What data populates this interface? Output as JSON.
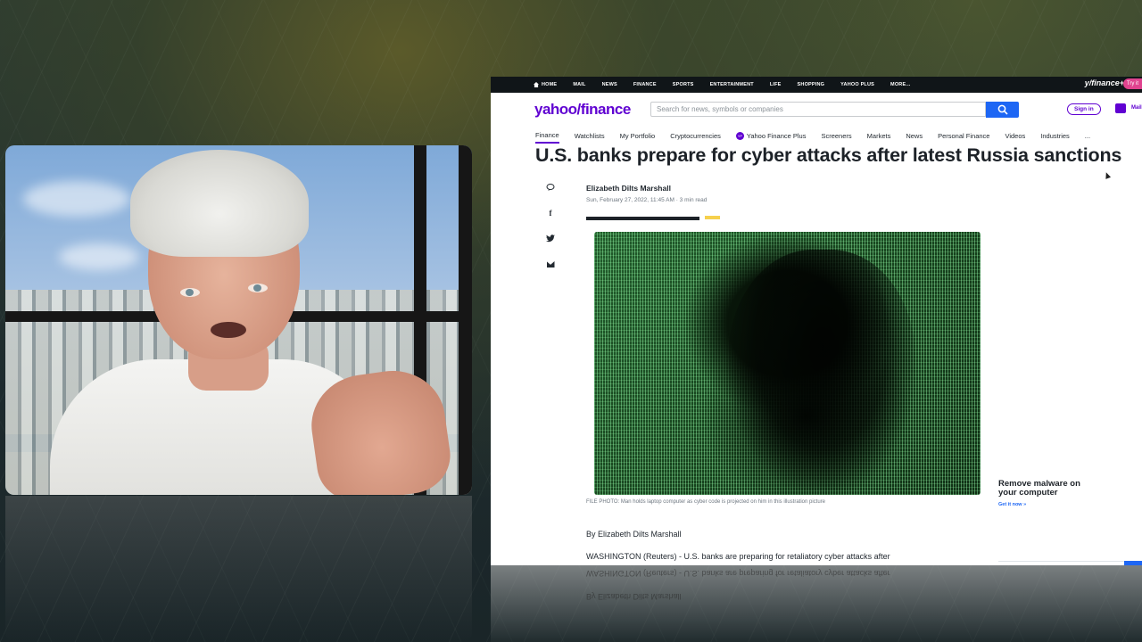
{
  "topnav": {
    "items": [
      "HOME",
      "MAIL",
      "NEWS",
      "FINANCE",
      "SPORTS",
      "ENTERTAINMENT",
      "LIFE",
      "SHOPPING",
      "YAHOO PLUS",
      "MORE..."
    ],
    "brand": "y/finance+",
    "try_label": "Try it"
  },
  "header": {
    "logo_text": "yahoo/finance",
    "search_placeholder": "Search for news, symbols or companies",
    "signin_label": "Sign in",
    "mail_label": "Mail"
  },
  "subnav": {
    "items": [
      "Finance",
      "Watchlists",
      "My Portfolio",
      "Cryptocurrencies",
      "Yahoo Finance Plus",
      "Screeners",
      "Markets",
      "News",
      "Personal Finance",
      "Videos",
      "Industries",
      "..."
    ],
    "active": "Finance"
  },
  "article": {
    "headline": "U.S. banks prepare for cyber attacks after latest Russia sanctions",
    "author": "Elizabeth Dilts Marshall",
    "date": "Sun, February 27, 2022, 11:45 AM",
    "read_time": "3 min read",
    "date_line": "Sun, February 27, 2022, 11:45 AM · 3 min read",
    "caption": "FILE PHOTO: Man holds laptop computer as cyber code is projected on him in this illustration picture",
    "byline": "By Elizabeth Dilts Marshall",
    "body_first_line": "WASHINGTON (Reuters) - U.S. banks are preparing for retaliatory cyber attacks after"
  },
  "ad": {
    "title": "Remove malware on your computer",
    "link": "Get it now »"
  },
  "colors": {
    "brand_purple": "#6001d2",
    "search_blue": "#1d66f4",
    "topnav_bg": "#101518",
    "progress_yellow": "#f6d04d"
  },
  "icons": [
    "home-icon",
    "search-icon",
    "mail-icon",
    "comment-icon",
    "facebook-icon",
    "twitter-icon",
    "email-share-icon",
    "yahoo-plus-badge-icon"
  ]
}
